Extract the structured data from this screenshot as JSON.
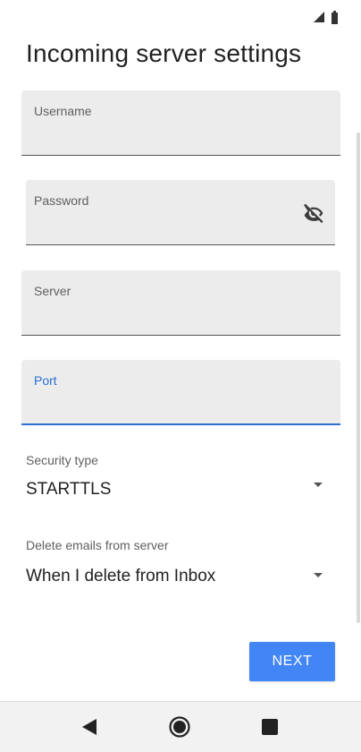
{
  "status_bar": {
    "icons": [
      "signal-icon",
      "battery-icon"
    ]
  },
  "page": {
    "title": "Incoming server settings"
  },
  "fields": {
    "username": {
      "label": "Username",
      "value": ""
    },
    "password": {
      "label": "Password",
      "value": "",
      "toggle_icon": "eye-off-icon"
    },
    "server": {
      "label": "Server",
      "value": ""
    },
    "port": {
      "label": "Port",
      "value": "",
      "focused": true
    }
  },
  "dropdowns": {
    "security_type": {
      "label": "Security type",
      "value": "STARTTLS"
    },
    "delete_emails": {
      "label": "Delete emails from server",
      "value": "When I delete from Inbox"
    }
  },
  "actions": {
    "next_label": "NEXT"
  },
  "nav_bar": {
    "icons": [
      "back-icon",
      "home-icon",
      "recents-icon"
    ]
  },
  "colors": {
    "accent": "#4285f4",
    "focus": "#2a6fd1",
    "field_bg": "#ececec"
  }
}
